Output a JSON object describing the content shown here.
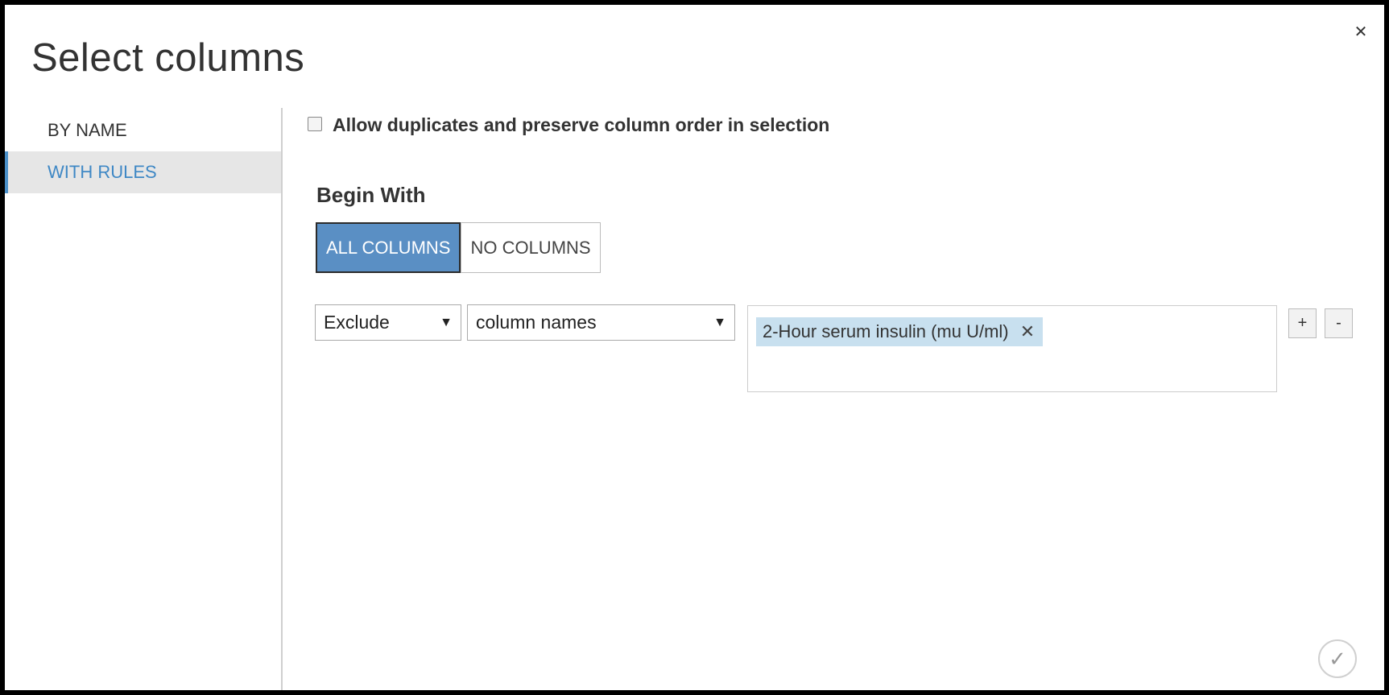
{
  "dialog": {
    "title": "Select columns",
    "close_icon": "✕",
    "ok_icon": "✓"
  },
  "sidebar": {
    "items": [
      {
        "label": "BY NAME",
        "active": false
      },
      {
        "label": "WITH RULES",
        "active": true
      }
    ]
  },
  "options": {
    "allow_duplicates_label": "Allow duplicates and preserve column order in selection",
    "allow_duplicates_checked": false
  },
  "begin_with": {
    "label": "Begin With",
    "buttons": [
      {
        "label": "ALL COLUMNS",
        "active": true
      },
      {
        "label": "NO COLUMNS",
        "active": false
      }
    ]
  },
  "rule": {
    "action_select": "Exclude",
    "type_select": "column names",
    "arrow_glyph": "▼",
    "tags": [
      {
        "label": "2-Hour serum insulin (mu U/ml)",
        "remove_glyph": "✕"
      }
    ],
    "add_label": "+",
    "remove_label": "-"
  }
}
